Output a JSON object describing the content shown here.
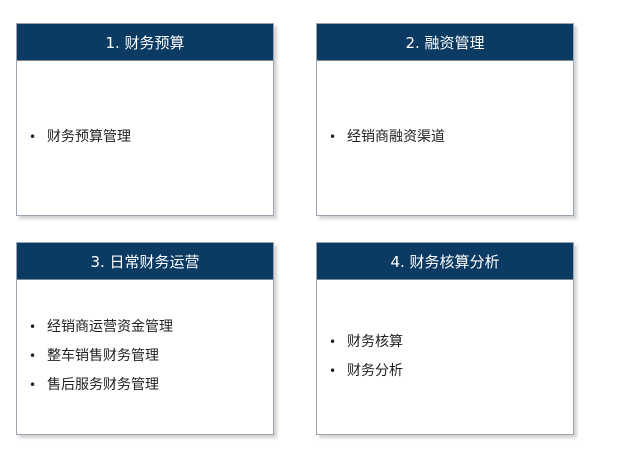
{
  "cards": [
    {
      "title": "1. 财务预算",
      "items": [
        "财务预算管理"
      ]
    },
    {
      "title": "2. 融资管理",
      "items": [
        "经销商融资渠道"
      ]
    },
    {
      "title": "3. 日常财务运营",
      "items": [
        "经销商运营资金管理",
        "整车销售财务管理",
        "售后服务财务管理"
      ]
    },
    {
      "title": "4. 财务核算分析",
      "items": [
        "财务核算",
        "财务分析"
      ]
    }
  ],
  "colors": {
    "header_bg": "#0b3a63",
    "header_text": "#ffffff",
    "border": "#9aa5b1"
  }
}
